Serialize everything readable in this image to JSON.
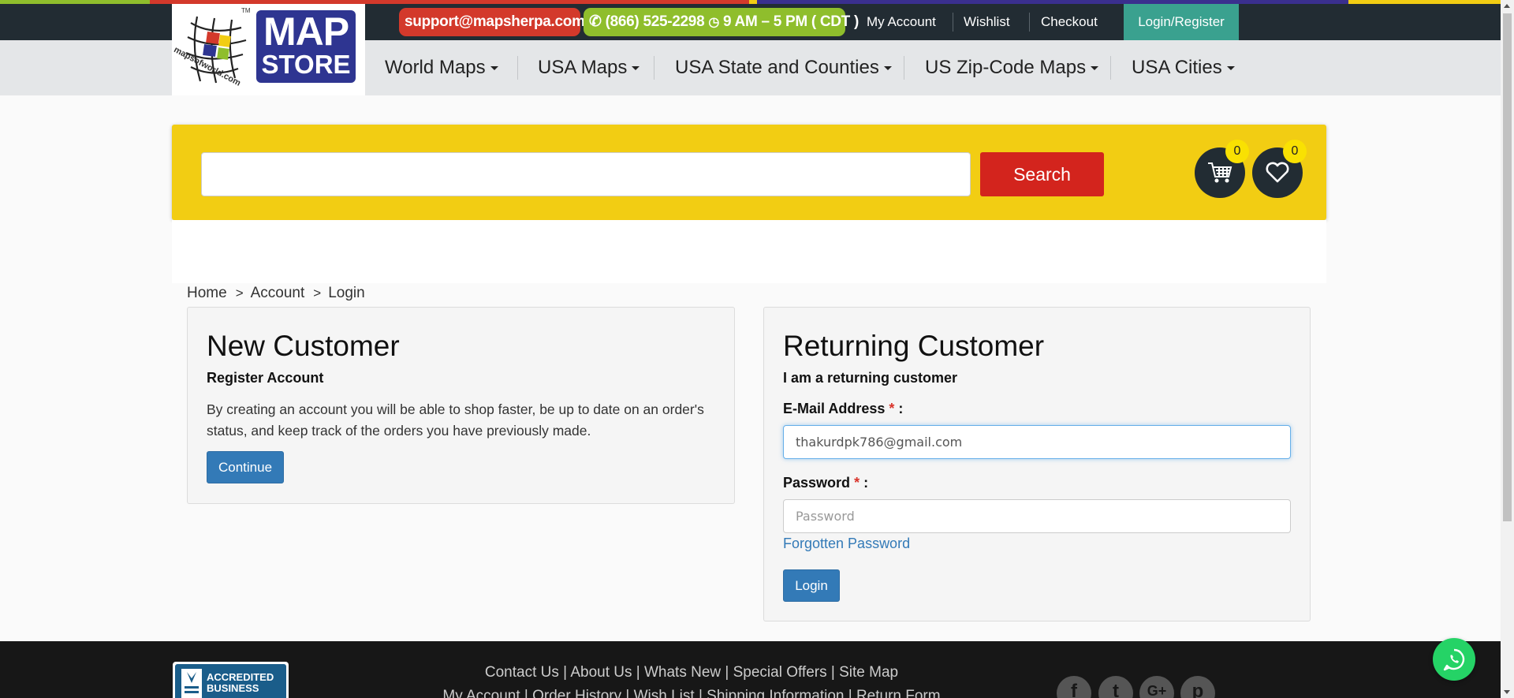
{
  "theme": {
    "topbar_color": "#222c33",
    "email_pill_color": "#d3392b",
    "phone_pill_color": "#8fbe2c",
    "login_color": "#3aa18f",
    "search_panel_color": "#f2cd13",
    "search_button_color": "#d3241d",
    "primary_button_color": "#337ab7",
    "color_strip": [
      "#8fbe2c",
      "#d3392b",
      "#f2cd13",
      "#3a2f8e",
      "#f2cd13"
    ]
  },
  "logo": {
    "brand_line1": "MAP",
    "brand_line2": "STORE",
    "site_text": "mapsofworld.com",
    "tm": "TM"
  },
  "topbar": {
    "email": "support@mapsherpa.com",
    "phone": "(866) 525-2298",
    "hours": "9 AM – 5 PM ( CDT )",
    "links": [
      "My Account",
      "Wishlist",
      "Checkout"
    ],
    "login_register": "Login/Register"
  },
  "nav": {
    "items": [
      "World Maps",
      "USA Maps",
      "USA State and Counties",
      "US Zip-Code Maps",
      "USA Cities"
    ]
  },
  "search": {
    "placeholder": "",
    "value": "",
    "button_label": "Search",
    "cart_count": "0",
    "wishlist_count": "0"
  },
  "breadcrumb": {
    "items": [
      "Home",
      "Account",
      "Login"
    ],
    "separator": ">"
  },
  "new_customer": {
    "title": "New Customer",
    "subtitle": "Register Account",
    "description": "By creating an account you will be able to shop faster, be up to date on an order's status, and keep track of the orders you have previously made.",
    "button_label": "Continue"
  },
  "returning_customer": {
    "title": "Returning Customer",
    "subtitle": "I am a returning customer",
    "email_label": "E-Mail Address",
    "email_value": "thakurdpk786@gmail.com",
    "password_label": "Password",
    "password_placeholder": "Password",
    "required_mark": "*",
    "label_suffix": ":",
    "forgot_label": "Forgotten Password",
    "login_label": "Login"
  },
  "footer": {
    "links_row1": [
      "Contact Us",
      "About Us",
      "Whats New",
      "Special Offers",
      "Site Map"
    ],
    "links_row2": [
      "My Account",
      "Order History",
      "Wish List",
      "Shipping Information",
      "Return Form"
    ],
    "bbb_line1": "ACCREDITED",
    "bbb_line2": "BUSINESS",
    "social": [
      "facebook-icon",
      "twitter-icon",
      "google-plus-icon",
      "pinterest-icon"
    ]
  }
}
